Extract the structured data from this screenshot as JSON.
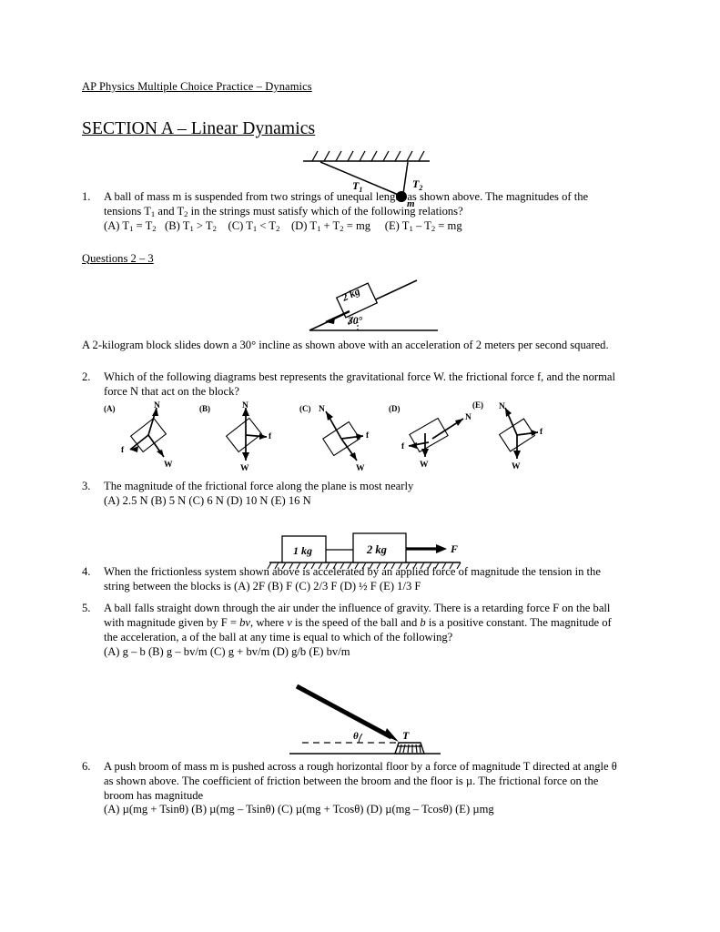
{
  "document": {
    "header": "AP Physics Multiple Choice Practice – Dynamics",
    "section_title": "SECTION A – Linear Dynamics"
  },
  "figures": {
    "two_strings": {
      "name": "ball-suspended-two-strings",
      "labels": {
        "t1": "T",
        "t1_sub": "1",
        "t2": "T",
        "t2_sub": "2",
        "mass": "m"
      }
    },
    "incline": {
      "name": "block-on-incline",
      "labels": {
        "block": "2 kg",
        "angle": "30°"
      }
    },
    "free_body_choices": [
      {
        "letter": "(A)",
        "normal": "N",
        "friction": "f",
        "weight": "W"
      },
      {
        "letter": "(B)",
        "normal": "N",
        "friction": "f",
        "weight": "W"
      },
      {
        "letter": "(C)",
        "normal": "N",
        "friction": "f",
        "weight": "W"
      },
      {
        "letter": "(D)",
        "normal": "N",
        "friction": "f",
        "weight": "W"
      },
      {
        "letter": "(E)",
        "normal": "N",
        "friction": "f",
        "weight": "W"
      }
    ],
    "two_blocks": {
      "name": "two-blocks-pulled-by-force",
      "labels": {
        "block1": "1 kg",
        "block2": "2 kg",
        "force": "F"
      }
    },
    "push_broom": {
      "name": "push-broom-on-floor",
      "labels": {
        "angle": "θ",
        "tension": "T"
      }
    }
  },
  "questions": [
    {
      "number": "1.",
      "text_line1": "A ball of mass m is suspended from two strings of unequal length as shown above. The magnitudes of the",
      "text_line2_a": "tensions T",
      "text_line2_sub1": "1",
      "text_line2_b": " and T",
      "text_line2_sub2": "2",
      "text_line2_c": " in the strings must satisfy which of the following relations?",
      "choices_html": "choices-q1"
    },
    {
      "number": "2.",
      "text_line1": "Which of the following diagrams best represents the gravitational force W. the frictional force f, and the normal",
      "text_line2": "force N that act on the block?"
    },
    {
      "number": "3.",
      "text_line1": "The magnitude of the frictional force along the plane is most nearly",
      "choices": "(A) 2.5 N      (B) 5 N      (C) 6 N      (D) 10 N      (E) 16 N"
    },
    {
      "number": "4.",
      "text_line1": "When the frictionless system shown above is accelerated by an applied force of magnitude the tension in the",
      "text_line2": "string between the blocks is      (A) 2F       (B) F     (C)  2/3 F     (D) ½ F     (E) 1/3 F"
    },
    {
      "number": "5.",
      "text_line1": "A ball falls straight down through the air under the influence of gravity. There is a retarding force F on the ball",
      "text_line2_a": "with magnitude given by F = ",
      "text_line2_bv": "bv",
      "text_line2_b": ", where ",
      "text_line2_v": "v",
      "text_line2_c": " is the speed of the ball and ",
      "text_line2_bconst": "b",
      "text_line2_d": " is a positive constant. The magnitude of",
      "text_line3_a": "the acceleration, a of the ball at any time is equal to which of the following?",
      "choices": "(A) g – b          (B) g – bv/m          (C) g + bv/m          (D) g/b          (E) bv/m"
    },
    {
      "number": "6.",
      "text_line1": "A push broom of mass m is pushed across a rough horizontal floor by a force of magnitude T directed at angle θ",
      "text_line2": "as shown above.  The coefficient of friction between the broom and the floor is µ. The frictional force on the",
      "text_line3": "broom has magnitude",
      "choices": "(A) µ(mg + Tsinθ)        (B) µ(mg – Tsinθ)      (C) µ(mg + Tcosθ)     (D) µ(mg – Tcosθ)      (E) µmg"
    }
  ],
  "q1_choices": {
    "a_pre": "(A) T",
    "a_sub1": "1",
    "a_mid": " = T",
    "a_sub2": "2",
    "b_pre": "(B) T",
    "b_sub1": "1",
    "b_mid": " > T",
    "b_sub2": "2",
    "c_pre": "(C) T",
    "c_sub1": "1",
    "c_mid": " < T",
    "c_sub2": "2",
    "d_pre": "(D) T",
    "d_sub1": "1",
    "d_mid": " + T",
    "d_sub2": "2",
    "d_end": " = mg",
    "e_pre": "(E) T",
    "e_sub1": "1",
    "e_mid": " – T",
    "e_sub2": "2",
    "e_end": " = mg"
  },
  "interstitial": {
    "questions_2_3": "Questions 2 – 3",
    "incline_description": "A 2-kilogram block slides down a 30° incline as shown above with an acceleration of 2 meters per second squared."
  },
  "colors": {
    "ink": "#000000",
    "paper": "#ffffff"
  }
}
